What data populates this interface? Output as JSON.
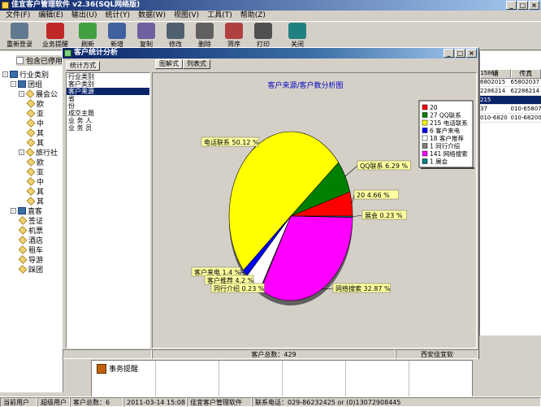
{
  "app": {
    "title": "佳宜客户管理软件 v2.36(SQL网络版)",
    "menu": [
      "文件(F)",
      "编辑(E)",
      "输出(U)",
      "统计(Y)",
      "数据(W)",
      "视图(V)",
      "工具(T)",
      "帮助(Z)"
    ],
    "toolbar": [
      "重新登录",
      "业务提醒",
      "刷新",
      "新增",
      "复制",
      "修改",
      "删除",
      "筛序",
      "打印",
      "关闭"
    ]
  },
  "left_panel": {
    "checkbox_label": "包含已停用",
    "tree": [
      {
        "label": "行业类别",
        "level": 0,
        "exp": "-"
      },
      {
        "label": "团组",
        "level": 1,
        "exp": "-"
      },
      {
        "label": "展会公",
        "level": 2,
        "exp": "-"
      },
      {
        "label": "欧",
        "level": 3
      },
      {
        "label": "亚",
        "level": 3
      },
      {
        "label": "中",
        "level": 3
      },
      {
        "label": "其",
        "level": 3
      },
      {
        "label": "其",
        "level": 3
      },
      {
        "label": "旅行社",
        "level": 2,
        "exp": "-"
      },
      {
        "label": "欧",
        "level": 3
      },
      {
        "label": "亚",
        "level": 3
      },
      {
        "label": "中",
        "level": 3
      },
      {
        "label": "其",
        "level": 3
      },
      {
        "label": "其",
        "level": 3
      },
      {
        "label": "直客",
        "level": 1,
        "exp": "-"
      },
      {
        "label": "签证",
        "level": 2
      },
      {
        "label": "机票",
        "level": 2
      },
      {
        "label": "酒店",
        "level": 2
      },
      {
        "label": "租车",
        "level": 2
      },
      {
        "label": "导游",
        "level": 2
      },
      {
        "label": "踩团",
        "level": 2
      }
    ]
  },
  "right_table": {
    "headers": [
      "话",
      "传真"
    ],
    "rows": [
      [
        "15868",
        ""
      ],
      [
        "6802015",
        "65802037"
      ],
      [
        "2286214",
        "62286214"
      ],
      [
        "215",
        ""
      ],
      [
        "37",
        "010-65807"
      ],
      [
        "010-6820",
        "010-68200"
      ]
    ]
  },
  "reminder": {
    "label": "事务提醒"
  },
  "statusbar": [
    "当前用户",
    "超级用户",
    "客户总数：6",
    "2011-03-14 15:08:08",
    "佳宜客户管理软件",
    "联系电话：029-86232425 or (0)13072908445"
  ],
  "dialog": {
    "title": "客户统计分析",
    "tab_method": "统计方式",
    "tab_pie": "图解式",
    "tab_list": "列表式",
    "methods": [
      "行业类别",
      "客户类别",
      "客户来源",
      "省",
      "份",
      "成交主题",
      "业 务 人",
      "业 务 员"
    ],
    "selected_method": 2,
    "status_total": "客户总数：429",
    "status_company": "西安佳宜软"
  },
  "chart_data": {
    "type": "pie",
    "title": "客户来源/客户数分析图",
    "slices": [
      {
        "name": "20",
        "value": 20,
        "label": "20 4.66 %",
        "color": "#ff0000"
      },
      {
        "name": "27 QQ联系",
        "value": 27,
        "label": "QQ联系 6.29 %",
        "color": "#008000"
      },
      {
        "name": "215 电话联系",
        "value": 215,
        "label": "电话联系 50.12 %",
        "color": "#ffff00"
      },
      {
        "name": "6 客户来电",
        "value": 6,
        "label": "客户来电 1.4 %",
        "color": "#0000ff"
      },
      {
        "name": "18 客户推荐",
        "value": 18,
        "label": "客户推荐 4.2 %",
        "color": "#ffffff"
      },
      {
        "name": "1 同行介绍",
        "value": 1,
        "label": "同行介绍 0.23 %",
        "color": "#808080"
      },
      {
        "name": "141 网络搜索",
        "value": 141,
        "label": "网络搜索 32.87 %",
        "color": "#ff00ff"
      },
      {
        "name": "1 展会",
        "value": 1,
        "label": "展会 0.23 %",
        "color": "#008080"
      }
    ]
  }
}
